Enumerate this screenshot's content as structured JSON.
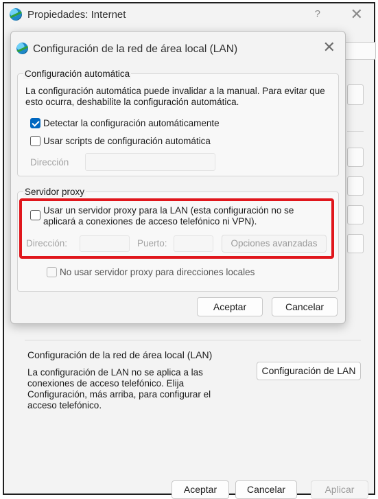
{
  "outer": {
    "title": "Propiedades: Internet",
    "help_icon": "?",
    "close_icon": "✕",
    "lan_section_title": "Configuración de la red de área local (LAN)",
    "lan_section_desc": "La configuración de LAN no se aplica a las conexiones de acceso telefónico. Elija Configuración, más arriba, para configurar el acceso telefónico.",
    "lan_button": "Configuración de LAN",
    "ok": "Aceptar",
    "cancel": "Cancelar",
    "apply": "Aplicar"
  },
  "dialog": {
    "title": "Configuración de la red de área local (LAN)",
    "close_icon": "✕",
    "auto_group_label": "Configuración automática",
    "auto_desc": "La configuración automática puede invalidar a la manual. Para evitar que esto ocurra, deshabilite la configuración automática.",
    "detect_label": "Detectar la configuración automáticamente",
    "detect_checked": true,
    "scripts_label": "Usar scripts de configuración automática",
    "scripts_checked": false,
    "address_label": "Dirección",
    "address_value": "",
    "proxy_group_label": "Servidor proxy",
    "proxy_label": "Usar un servidor proxy para la LAN (esta configuración no se aplicará a conexiones de acceso telefónico ni VPN).",
    "proxy_checked": false,
    "proxy_address_label": "Dirección:",
    "proxy_address_value": "",
    "port_label": "Puerto:",
    "port_value": "",
    "advanced_button": "Opciones avanzadas",
    "bypass_label": "No usar servidor proxy para direcciones locales",
    "bypass_checked": false,
    "ok": "Aceptar",
    "cancel": "Cancelar"
  },
  "colors": {
    "accent": "#0067c0",
    "highlight": "#e0161c"
  },
  "icons": {
    "app": "internet-options-globe-icon"
  }
}
